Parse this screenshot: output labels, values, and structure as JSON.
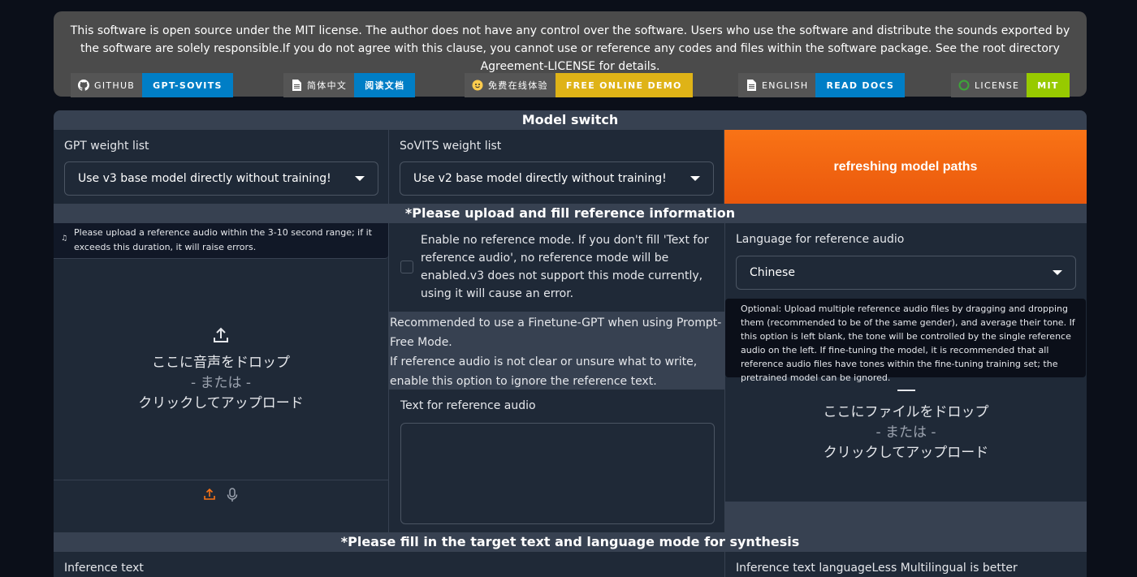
{
  "banner": {
    "notice": "This software is open source under the MIT license. The author does not have any control over the software. Users who use the software and distribute the sounds exported by the software are solely responsible.If you do not agree with this clause, you cannot use or reference any codes and files within the software package. See the root directory Agreement-LICENSE for details.",
    "badges": [
      {
        "left": "GITHUB",
        "right": "GPT-SOVITS",
        "color": "#007ec6",
        "icon": "github-icon"
      },
      {
        "left": "简体中文",
        "right": "阅读文档",
        "color": "#007ec6",
        "icon": "document-icon"
      },
      {
        "left": "免费在线体验",
        "right": "FREE ONLINE DEMO",
        "color": "#dfb317",
        "icon": "huggingface-icon"
      },
      {
        "left": "ENGLISH",
        "right": "READ DOCS",
        "color": "#007ec6",
        "icon": "document-icon"
      },
      {
        "left": "LICENSE",
        "right": "MIT",
        "color": "#97ca00",
        "icon": "open-source-icon"
      }
    ]
  },
  "model_switch": {
    "header": "Model switch",
    "gpt_label": "GPT weight list",
    "gpt_value": "Use v3 base model directly without training!",
    "sovits_label": "SoVITS weight list",
    "sovits_value": "Use v2 base model directly without training!",
    "refresh_label": "refreshing model paths"
  },
  "reference": {
    "header": "*Please upload and fill reference information",
    "audio_hint": "Please upload a reference audio within the 3-10 second range; if it exceeds this duration, it will raise errors.",
    "drop_text": "ここに音声をドロップ",
    "or_text": "- または -",
    "click_text": "クリックしてアップロード",
    "no_ref_label": "Enable no reference mode. If you don't fill 'Text for reference audio', no reference mode will be enabled.v3 does not support this mode currently, using it will cause an error.",
    "recommend_line1": "Recommended to use a Finetune-GPT when using Prompt-Free Mode.",
    "recommend_line2": "If reference audio is not clear or unsure what to write, enable this option to ignore the reference text.",
    "text_label": "Text for reference audio",
    "text_value": "",
    "lang_label": "Language for reference audio",
    "lang_value": "Chinese",
    "multi_hint": "Optional: Upload multiple reference audio files by dragging and dropping them (recommended to be of the same gender), and average their tone. If this option is left blank, the tone will be controlled by the single reference audio on the left. If fine-tuning the model, it is recommended that all reference audio files have tones within the fine-tuning training set; the pretrained model can be ignored.",
    "file_drop_text": "ここにファイルをドロップ",
    "file_or_text": "- または -",
    "file_click_text": "クリックしてアップロード"
  },
  "synthesis": {
    "header": "*Please fill in the target text and language mode for synthesis",
    "inference_label": "Inference text",
    "inference_lang_label": "Inference text languageLess Multilingual is better"
  },
  "colors": {
    "accent": "#f97316",
    "background": "#0b0f19",
    "panel": "#1f2937",
    "block": "#374151"
  }
}
